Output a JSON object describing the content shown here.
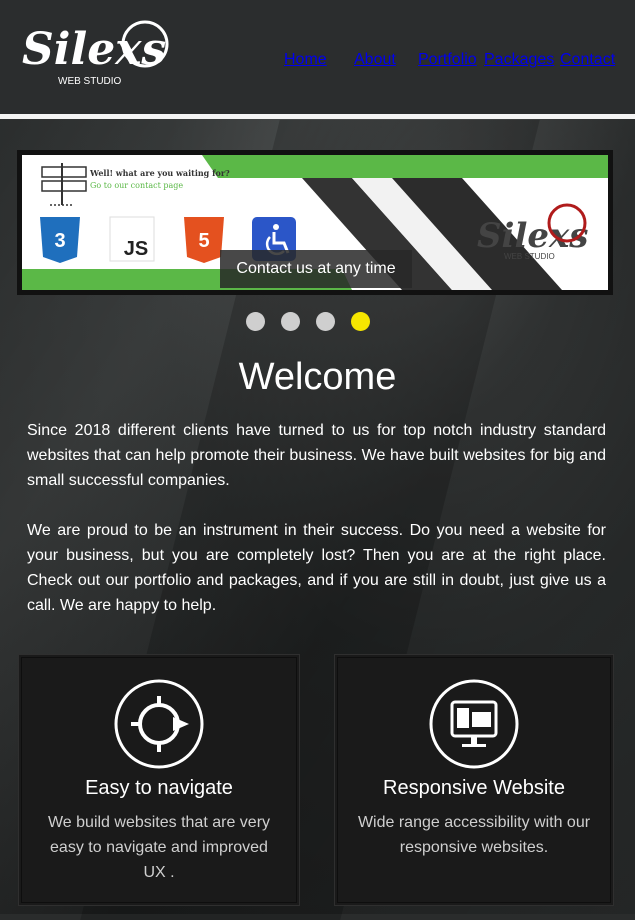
{
  "header": {
    "logo": {
      "text": "Silexs",
      "subtext": "WEB STUDIO"
    },
    "nav": [
      {
        "label": "Home"
      },
      {
        "label": "About"
      },
      {
        "label": "Portfolio"
      },
      {
        "label": "Packages"
      },
      {
        "label": "Contact"
      }
    ]
  },
  "slider": {
    "banner_line1": "Well! what are you waiting for?",
    "banner_line2": "Go to our contact page",
    "tech_icons": [
      "css3-icon",
      "js-icon",
      "html5-icon",
      "accessibility-icon"
    ],
    "banner_logo": {
      "text": "Silexs",
      "subtext": "WEB STUDIO"
    },
    "caption": "Contact us at any time",
    "dots": [
      false,
      false,
      false,
      true
    ],
    "active_dot_color": "#f6e600"
  },
  "welcome": {
    "title": "Welcome",
    "paragraphs": [
      "Since 2018 different clients have turned to us for top notch industry standard websites that can help promote their business. We have built websites for big and small successful companies.",
      "We are proud to be an instrument in their success. Do you need a website for your business, but you are completely lost? Then you are at the right place. Check out our portfolio and packages, and if you are still in doubt, just give us a call. We are happy to help."
    ]
  },
  "features": [
    {
      "icon": "navigation-icon",
      "title": "Easy to navigate",
      "text": "We build websites that are very easy to navigate and improved UX ."
    },
    {
      "icon": "monitor-icon",
      "title": "Responsive Website",
      "text": "Wide range accessibility with our responsive websites."
    }
  ],
  "colors": {
    "header_bg": "#2b2d2e",
    "accent_green": "#5bb847",
    "brand_red": "#b01b1b",
    "card_bg": "#1a1a1a"
  }
}
